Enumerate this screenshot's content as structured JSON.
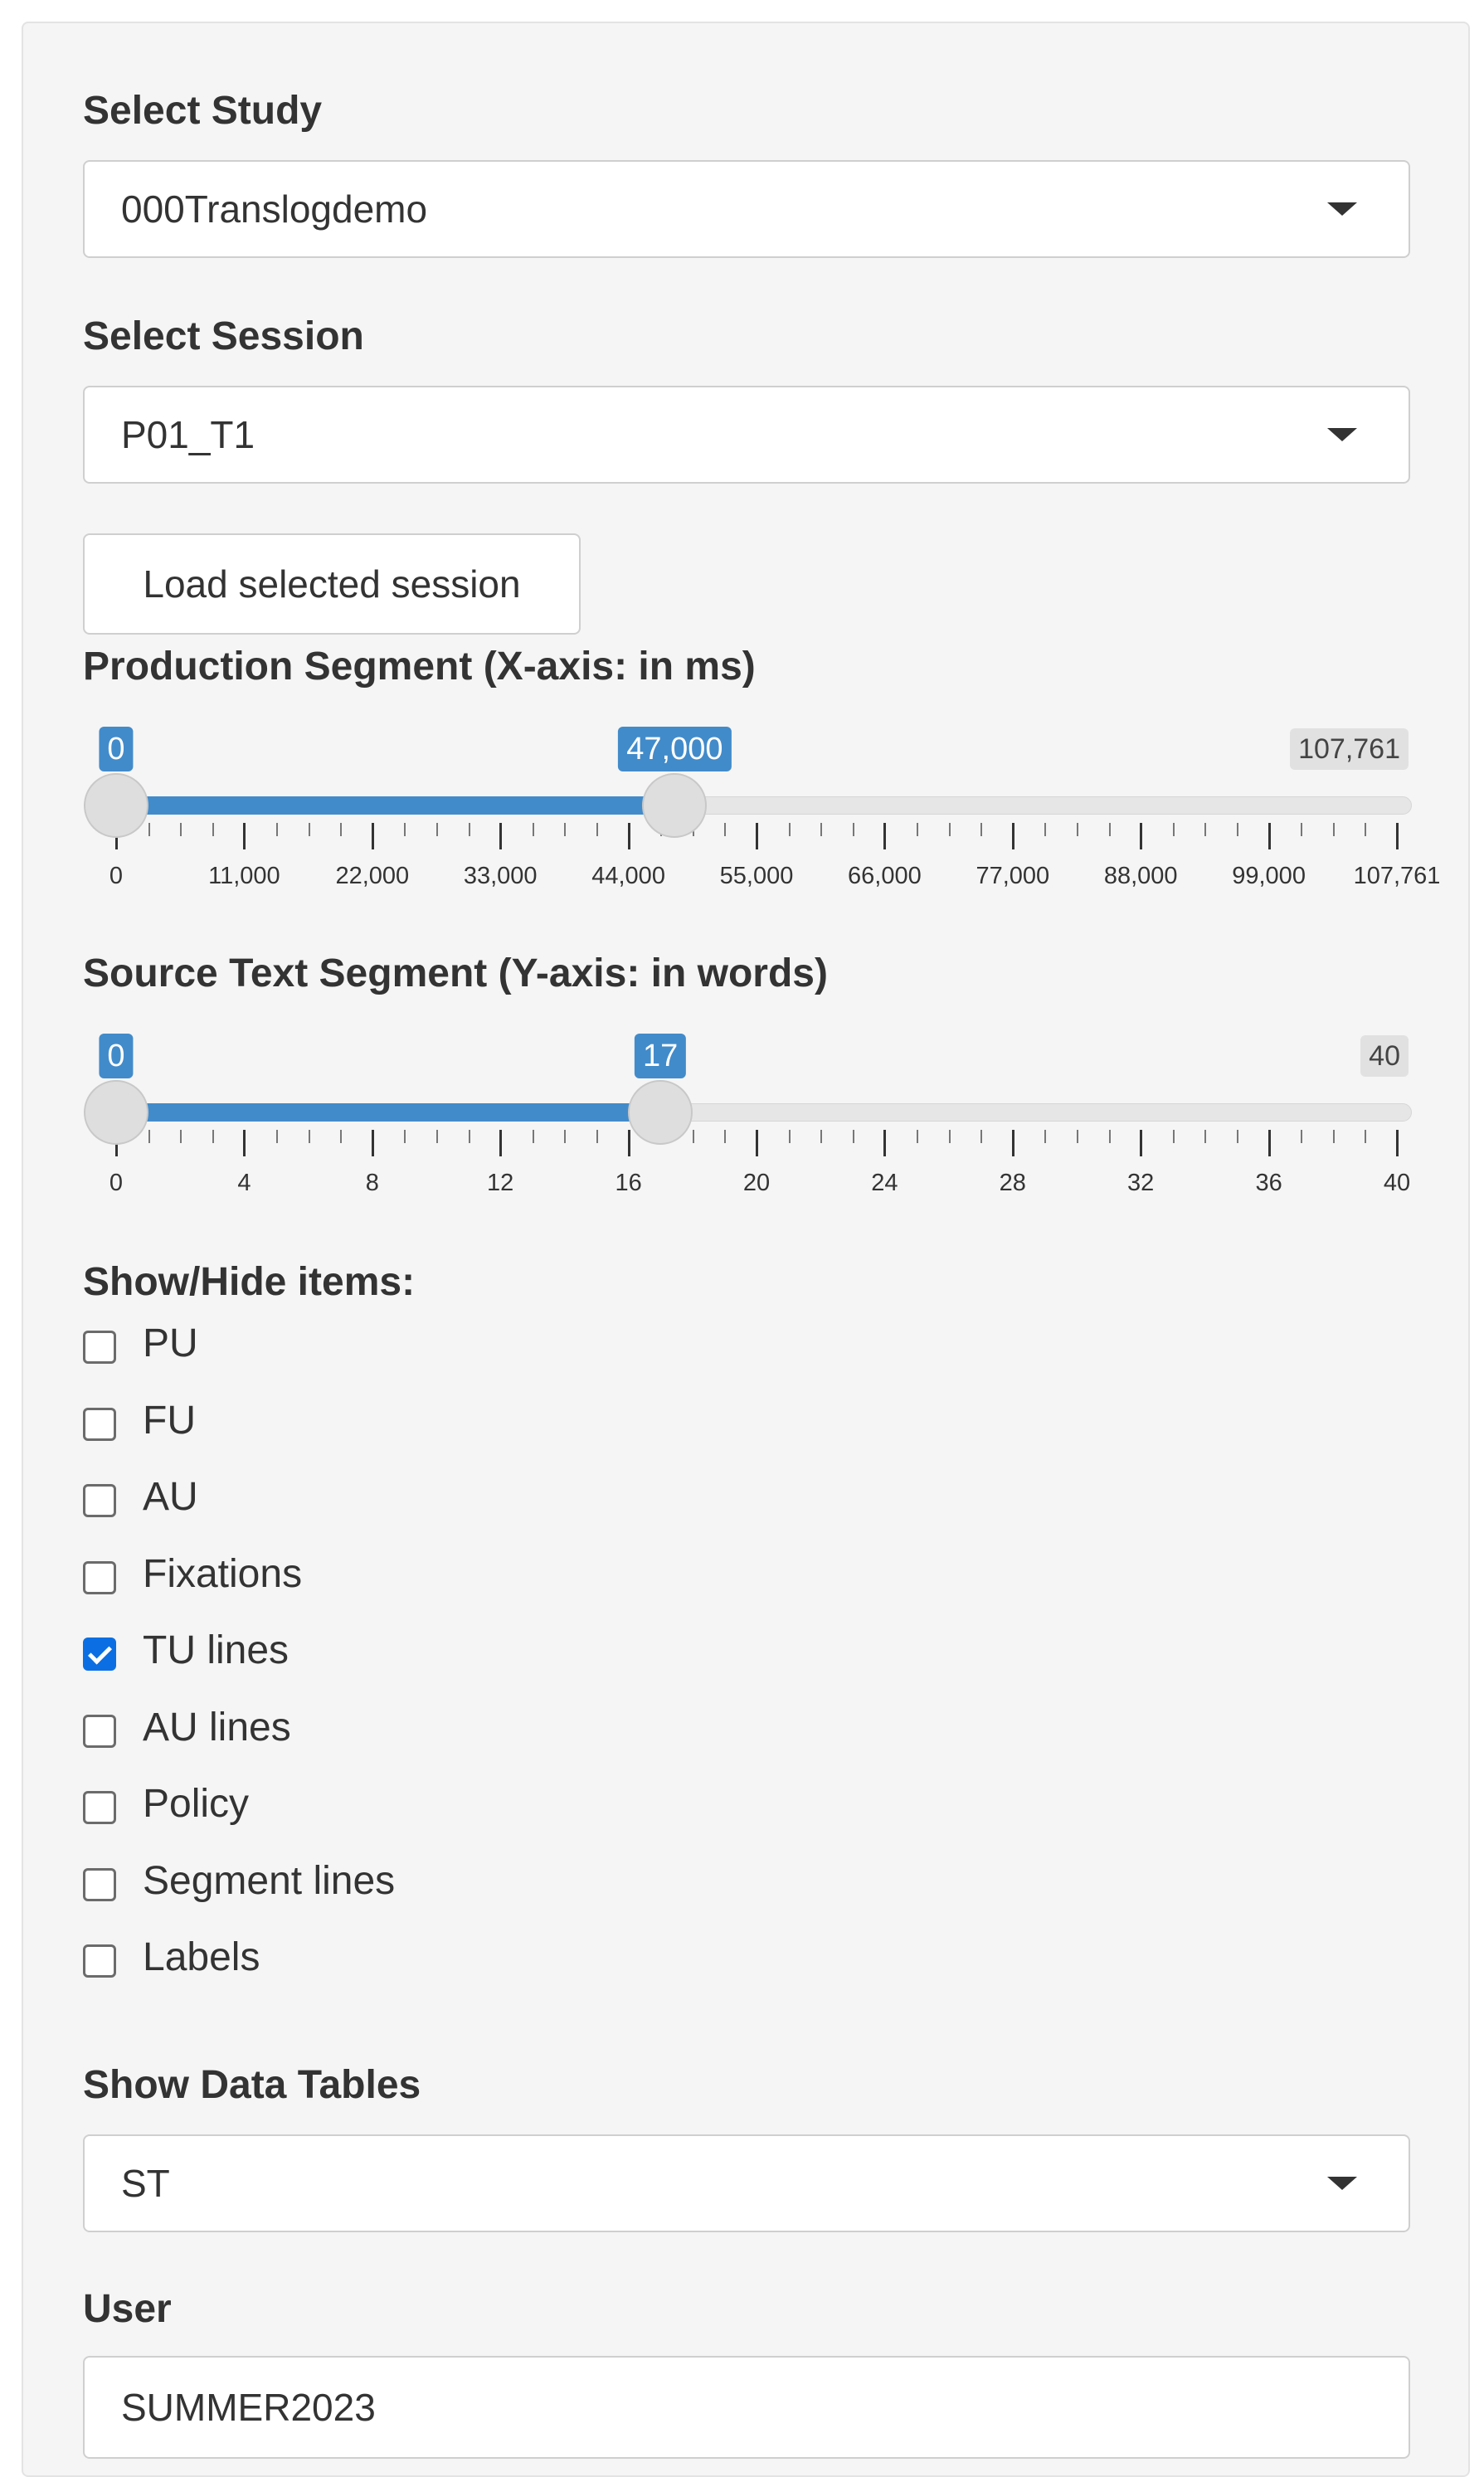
{
  "study": {
    "label": "Select Study",
    "value": "000Translogdemo"
  },
  "session": {
    "label": "Select Session",
    "value": "P01_T1"
  },
  "load_button": "Load selected session",
  "x_slider": {
    "label": "Production Segment (X-axis: in ms)",
    "min_label": "0",
    "value_label": "47,000",
    "max_label": "107,761",
    "min": 0,
    "max": 107761,
    "from": 0,
    "to": 47000,
    "ticks": [
      "0",
      "11,000",
      "22,000",
      "33,000",
      "44,000",
      "55,000",
      "66,000",
      "77,000",
      "88,000",
      "99,000",
      "107,761"
    ]
  },
  "y_slider": {
    "label": "Source Text Segment (Y-axis: in words)",
    "min_label": "0",
    "value_label": "17",
    "max_label": "40",
    "min": 0,
    "max": 40,
    "from": 0,
    "to": 17,
    "ticks": [
      "0",
      "4",
      "8",
      "12",
      "16",
      "20",
      "24",
      "28",
      "32",
      "36",
      "40"
    ]
  },
  "show_hide": {
    "label": "Show/Hide items:",
    "items": [
      {
        "label": "PU",
        "checked": false
      },
      {
        "label": "FU",
        "checked": false
      },
      {
        "label": "AU",
        "checked": false
      },
      {
        "label": "Fixations",
        "checked": false
      },
      {
        "label": "TU lines",
        "checked": true
      },
      {
        "label": "AU lines",
        "checked": false
      },
      {
        "label": "Policy",
        "checked": false
      },
      {
        "label": "Segment lines",
        "checked": false
      },
      {
        "label": "Labels",
        "checked": false
      }
    ]
  },
  "data_tables": {
    "label": "Show Data Tables",
    "value": "ST"
  },
  "user": {
    "label": "User",
    "value": "SUMMER2023"
  },
  "colors": {
    "accent": "#428bca",
    "checkbox": "#0b6fe3",
    "panel": "#f5f5f5"
  }
}
